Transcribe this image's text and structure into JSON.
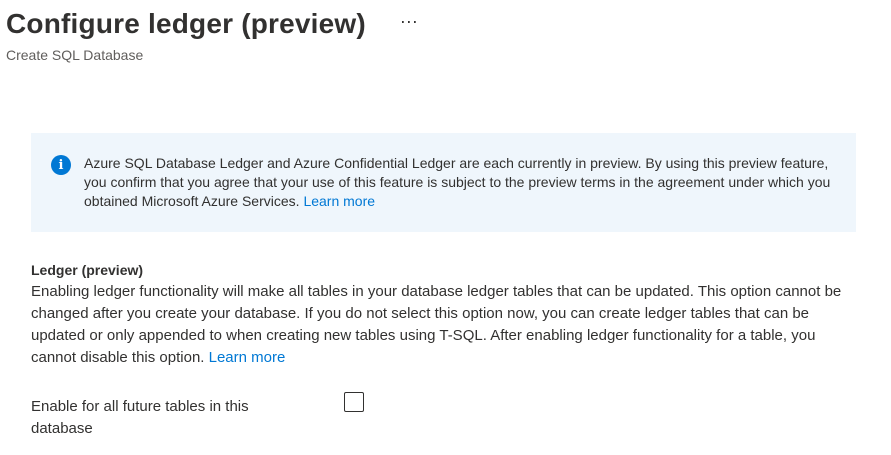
{
  "header": {
    "title": "Configure ledger (preview)",
    "subtitle": "Create SQL Database",
    "more_label": "···"
  },
  "info_banner": {
    "icon": "info-icon",
    "icon_glyph": "i",
    "text": "Azure SQL Database Ledger and Azure Confidential Ledger are each currently in preview. By using this preview feature, you confirm that you agree that your use of this feature is subject to the preview terms in the agreement under which you obtained Microsoft Azure Services.",
    "link": "Learn more",
    "background": "#eff6fc",
    "icon_color": "#0078d4"
  },
  "ledger": {
    "title": "Ledger (preview)",
    "description": "Enabling ledger functionality will make all tables in your database ledger tables that can be updated. This option cannot be changed after you create your database. If you do not select this option now, you can create ledger tables that can be updated or only appended to when creating new tables using T-SQL. After enabling ledger functionality for a table, you cannot disable this option.",
    "link": "Learn more"
  },
  "option": {
    "label": "Enable for all future tables in this database",
    "checked": false
  },
  "colors": {
    "link": "#0078d4",
    "text": "#323130"
  }
}
